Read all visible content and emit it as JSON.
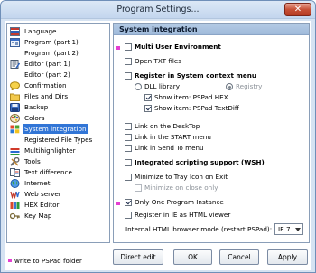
{
  "window": {
    "title": "Program Settings...",
    "close_glyph": "✕"
  },
  "sidebar": {
    "items": [
      {
        "label": "Language",
        "icon": "language-icon"
      },
      {
        "label": "Program  (part 1)",
        "icon": "program-icon"
      },
      {
        "label": "Program  (part 2)",
        "icon": "none"
      },
      {
        "label": "Editor  (part 1)",
        "icon": "editor-icon"
      },
      {
        "label": "Editor  (part 2)",
        "icon": "none"
      },
      {
        "label": "Confirmation",
        "icon": "confirmation-icon"
      },
      {
        "label": "Files and Dirs",
        "icon": "folder-icon"
      },
      {
        "label": "Backup",
        "icon": "backup-icon"
      },
      {
        "label": "Colors",
        "icon": "colors-icon"
      },
      {
        "label": "System integration",
        "icon": "windows-icon",
        "selected": true
      },
      {
        "label": "Registered File Types",
        "icon": "none"
      },
      {
        "label": "Multihighlighter",
        "icon": "highlighter-icon"
      },
      {
        "label": "Tools",
        "icon": "tools-icon"
      },
      {
        "label": "Text difference",
        "icon": "text-difference-icon"
      },
      {
        "label": "Internet",
        "icon": "internet-icon"
      },
      {
        "label": "Web server",
        "icon": "web-server-icon"
      },
      {
        "label": "HEX Editor",
        "icon": "hex-editor-icon"
      },
      {
        "label": "Key Map",
        "icon": "key-map-icon"
      }
    ]
  },
  "panel": {
    "header": "System integration",
    "options": {
      "multi_user": "Multi User Environment",
      "open_txt": "Open TXT files",
      "register_context": "Register in System context menu",
      "dll_library": "DLL library",
      "registry": "Registry",
      "show_hex": "Show item: PSPad HEX",
      "show_textdiff": "Show item: PSPad TextDiff",
      "link_desktop": "Link on the DeskTop",
      "link_start": "Link in the START menu",
      "link_sendto": "Link in Send To menu",
      "integrated_scripting": "Integrated scripting support (WSH)",
      "minimize_tray": "Minimize to Tray Icon on Exit",
      "minimize_close": "Minimize on close only",
      "single_instance": "Only One Program Instance",
      "register_ie": "Register in IE as HTML viewer"
    },
    "browser_mode_label": "Internal HTML browser mode (restart PSPad):",
    "browser_mode_value": "IE 7"
  },
  "footer": {
    "note": "write to PSPad folder",
    "buttons": {
      "direct_edit": "Direct edit",
      "ok": "OK",
      "cancel": "Cancel",
      "apply": "Apply"
    }
  },
  "colors": {
    "marker": "#e43fd2",
    "selection": "#3175d6",
    "header": "#a9c3e0"
  }
}
